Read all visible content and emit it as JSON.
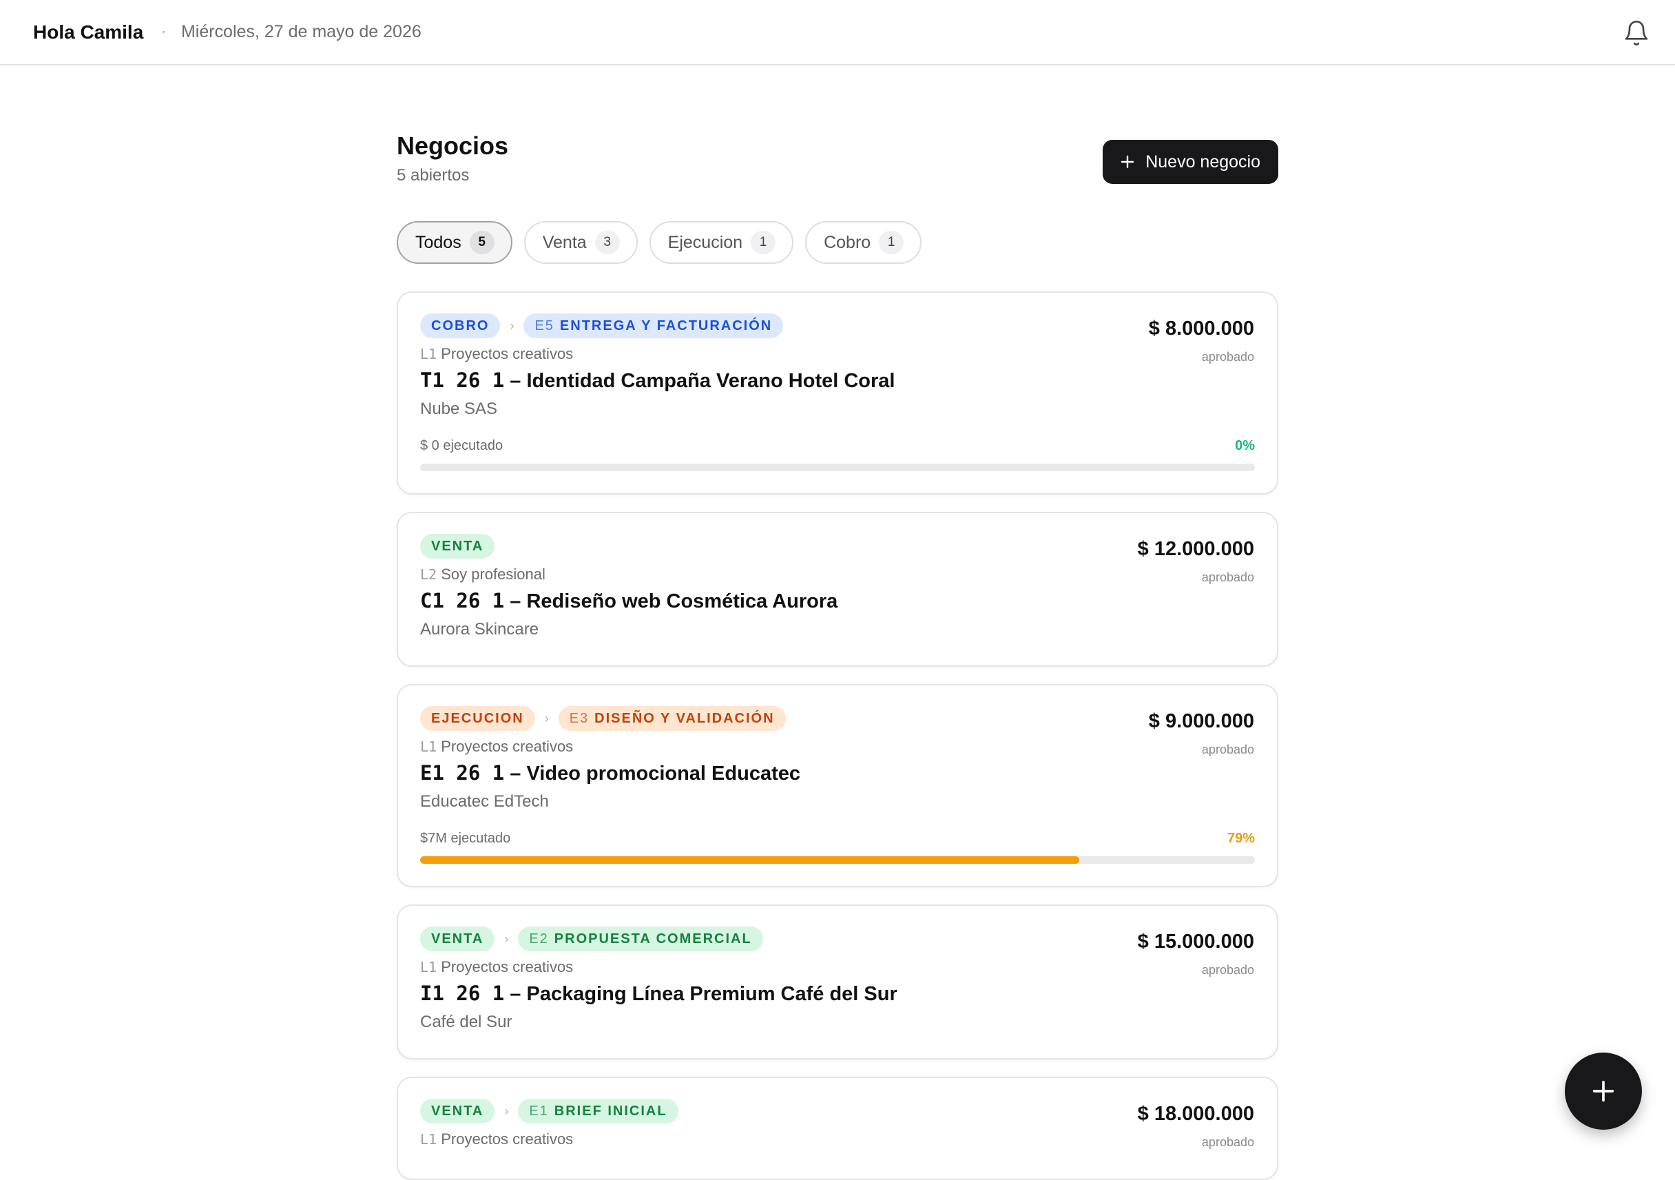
{
  "header": {
    "greeting": "Hola Camila",
    "separator": "·",
    "date": "Miércoles, 27 de mayo de 2026",
    "icon": "bell-icon"
  },
  "page": {
    "title": "Negocios",
    "subtitle": "5 abiertos",
    "new_button_label": "Nuevo negocio"
  },
  "filters": [
    {
      "label": "Todos",
      "count": "5",
      "active": true
    },
    {
      "label": "Venta",
      "count": "3",
      "active": false
    },
    {
      "label": "Ejecucion",
      "count": "1",
      "active": false
    },
    {
      "label": "Cobro",
      "count": "1",
      "active": false
    }
  ],
  "deals": [
    {
      "stage": "COBRO",
      "substage_code": "E5",
      "substage": "ENTREGA Y FACTURACIÓN",
      "line_code": "L1",
      "line": "Proyectos creativos",
      "code": "T1 26 1",
      "dash": "–",
      "title": "Identidad Campaña Verano Hotel Coral",
      "client": "Nube SAS",
      "amount": "$ 8.000.000",
      "amount_note": "aprobado",
      "executed": "$ 0 ejecutado",
      "percent": "0%",
      "progress": 0
    },
    {
      "stage": "VENTA",
      "line_code": "L2",
      "line": "Soy profesional",
      "code": "C1 26 1",
      "dash": "–",
      "title": "Rediseño web Cosmética Aurora",
      "client": "Aurora Skincare",
      "amount": "$ 12.000.000",
      "amount_note": "aprobado"
    },
    {
      "stage": "EJECUCION",
      "substage_code": "E3",
      "substage": "DISEÑO Y VALIDACIÓN",
      "line_code": "L1",
      "line": "Proyectos creativos",
      "code": "E1 26 1",
      "dash": "–",
      "title": "Video promocional Educatec",
      "client": "Educatec EdTech",
      "amount": "$ 9.000.000",
      "amount_note": "aprobado",
      "executed": "$7M ejecutado",
      "percent": "79%",
      "progress": 0.79
    },
    {
      "stage": "VENTA",
      "substage_code": "E2",
      "substage": "PROPUESTA COMERCIAL",
      "line_code": "L1",
      "line": "Proyectos creativos",
      "code": "I1 26 1",
      "dash": "–",
      "title": "Packaging Línea Premium Café del Sur",
      "client": "Café del Sur",
      "amount": "$ 15.000.000",
      "amount_note": "aprobado"
    },
    {
      "stage": "VENTA",
      "substage_code": "E1",
      "substage": "BRIEF INICIAL",
      "line_code": "L1",
      "line": "Proyectos creativos",
      "amount": "$ 18.000.000",
      "amount_note": "aprobado"
    }
  ],
  "colors": {
    "cobro_bg": "#dbe8ff",
    "cobro_text": "#1d4ed8",
    "venta_bg": "#d6f5e3",
    "venta_text": "#15803d",
    "ejecucion_bg": "#ffe6d0",
    "ejecucion_text": "#c2410c",
    "progress_zero": "#10b981",
    "progress_orange": "#f59e0b"
  },
  "fab_icon": "plus-icon"
}
